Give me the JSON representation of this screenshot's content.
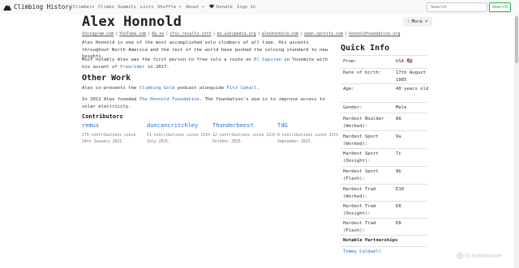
{
  "nav": {
    "brand": "Climbing History",
    "links": [
      "Climbers",
      "Climbs",
      "Summits",
      "Lists",
      "Shuffle ▾",
      "About ▾",
      "Donate",
      "Sign In"
    ],
    "search_placeholder": "Search",
    "search_button": "Search"
  },
  "page": {
    "title": "Alex Honnold",
    "more_button": "⁝ More ▾",
    "links": [
      "Instagram.com",
      "YouTube.com",
      "8a.nu",
      "ifsc.results.info",
      "en.wikipedia.org",
      "alexhonnold.com",
      "open.spotify.com",
      "honnoldfoundation.org"
    ],
    "intro": "Alex Honnold is one of the most accomplished solo climbers of all time. His ascents throughout North America and the rest of the world have pushed the soloing standard to new heights.",
    "solo_before": "Most notably Alex was the first person to free solo a route on ",
    "solo_link1": "El Capitan",
    "solo_middle": " in Yosemite with his ascent of ",
    "solo_link2": "Freerider",
    "solo_after": " in 2017.",
    "other_work_heading": "Other Work",
    "podcast_before": "Alex co-presents the ",
    "podcast_link1": "Climbing Gold",
    "podcast_middle": " podcast alongside ",
    "podcast_link2": "Fitz Cahall",
    "podcast_after": ".",
    "foundation_before": "In 2012 Alex founded ",
    "foundation_link": "The Honnold Foundation",
    "foundation_after": ". The foundation's aim is to improve access to solar electricity.",
    "contributors_heading": "Contributors",
    "contributors": [
      {
        "name": "remus",
        "info": "179 contributions since 24th January 2021."
      },
      {
        "name": "duncancritchley",
        "info": "51 contributions since 15th July 2025."
      },
      {
        "name": "Thunderbeest",
        "info": "12 contributions since 12th October 2025."
      },
      {
        "name": "TdG",
        "info": "9 contributions since 13th September 2025."
      }
    ]
  },
  "quick_info": {
    "title": "Quick Info",
    "rows": [
      {
        "label": "From:",
        "value": "USA",
        "flag": "🇺🇸"
      },
      {
        "label": "Date of birth:",
        "value": "17th August 1985"
      },
      {
        "label": "Age:",
        "value": "40 years old"
      },
      {
        "label": "Gender:",
        "value": "Male"
      },
      {
        "label": "Hardest Boulder (Worked):",
        "value": "8A"
      },
      {
        "label": "Hardest Sport (Worked):",
        "value": "9a"
      },
      {
        "label": "Hardest Sport (Onsight):",
        "value": "7c"
      },
      {
        "label": "Hardest Sport (Flash):",
        "value": "8b"
      },
      {
        "label": "Hardest Trad (Worked):",
        "value": "E10"
      },
      {
        "label": "Hardest Trad (Onsight):",
        "value": "E8"
      },
      {
        "label": "Hardest Trad (Flash):",
        "value": "E8"
      }
    ],
    "partnerships_title": "Notable Partnerships",
    "partner": "Tommy Caldwell"
  },
  "watermark": "ScanMalware",
  "colors": {
    "link": "#2a6ec4",
    "search_button": "#28a745",
    "nav_bg": "#f8f9fa"
  }
}
